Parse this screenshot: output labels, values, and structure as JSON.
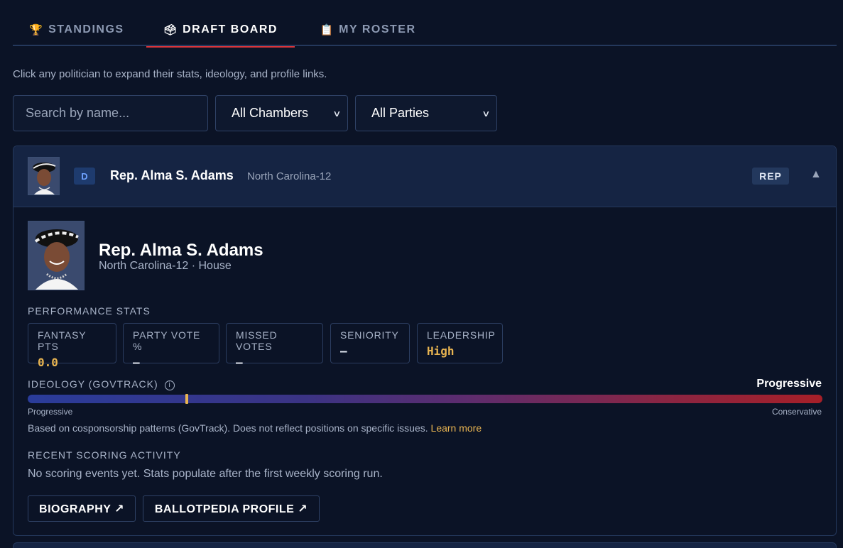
{
  "tabs": [
    {
      "icon": "🏆",
      "label": "STANDINGS"
    },
    {
      "icon": "🗳",
      "label": "DRAFT BOARD"
    },
    {
      "icon": "📋",
      "label": "MY ROSTER"
    }
  ],
  "hint": "Click any politician to expand their stats, ideology, and profile links.",
  "filters": {
    "search_placeholder": "Search by name...",
    "chamber_selected": "All Chambers",
    "party_selected": "All Parties"
  },
  "politician": {
    "party_badge": "D",
    "name": "Rep. Alma S. Adams",
    "district": "North Carolina-12",
    "chamber_badge": "REP",
    "subtitle": "North Carolina-12 · House",
    "collapse_glyph": "▲"
  },
  "performance": {
    "section_label": "PERFORMANCE STATS",
    "stats": [
      {
        "label": "FANTASY PTS",
        "value": "0.0"
      },
      {
        "label": "PARTY VOTE %",
        "value": "—"
      },
      {
        "label": "MISSED VOTES",
        "value": "—"
      },
      {
        "label": "SENIORITY",
        "value": "—"
      },
      {
        "label": "LEADERSHIP",
        "value": "High"
      }
    ]
  },
  "ideology": {
    "label": "IDEOLOGY (GOVTRACK)",
    "info_glyph": "i",
    "value_label": "Progressive",
    "score": 0.2,
    "scale_left": "Progressive",
    "scale_right": "Conservative",
    "note": "Based on cosponsorship patterns (GovTrack). Does not reflect positions on specific issues.",
    "learn_more": "Learn more"
  },
  "activity": {
    "section_label": "RECENT SCORING ACTIVITY",
    "empty_text": "No scoring events yet. Stats populate after the first weekly scoring run."
  },
  "links": [
    {
      "label": "BIOGRAPHY ↗"
    },
    {
      "label": "BALLOTPEDIA PROFILE ↗"
    }
  ],
  "colors": {
    "background": "#0b1326",
    "accent_red": "#d9353b",
    "gold": "#e8b451",
    "democrat_blue": "#6fa2ff"
  }
}
